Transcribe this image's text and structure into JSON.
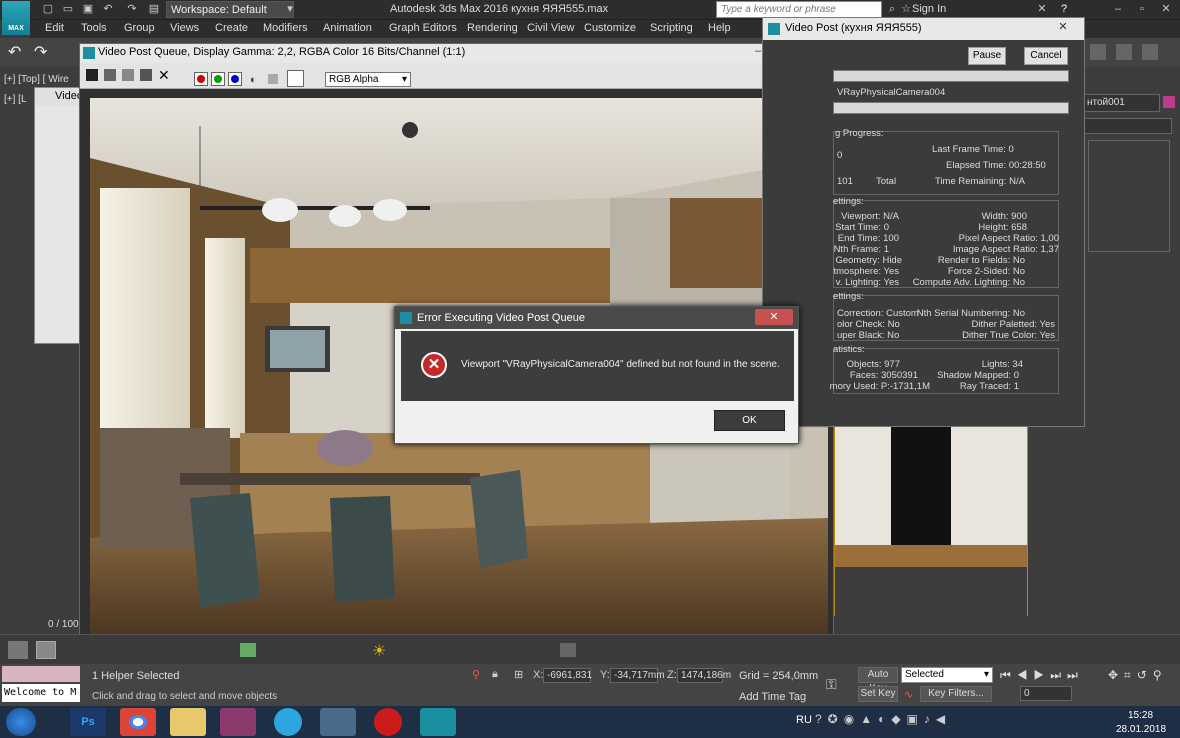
{
  "app": {
    "title": "Autodesk 3ds Max 2016      кухня ЯЯЯ555.max",
    "logo": "MAX",
    "workspace": "Workspace: Default",
    "search_placeholder": "Type a keyword or phrase",
    "signin": "Sign In"
  },
  "menu": [
    "Edit",
    "Tools",
    "Group",
    "Views",
    "Create",
    "Modifiers",
    "Animation",
    "Graph Editors",
    "Rendering",
    "Civil View",
    "Customize",
    "Scripting",
    "Help"
  ],
  "viewport": {
    "label": "[+] [Top] [ Wire",
    "label2": "[+] [L",
    "frame_counter": "0 / 100",
    "right_label": "нтой001"
  },
  "small_window": {
    "title": "Video"
  },
  "video_post_queue": {
    "title": "Video Post Queue, Display Gamma: 2,2, RGBA Color 16 Bits/Channel (1:1)",
    "channel": "RGB Alpha",
    "swatch_colors": [
      "#d00000",
      "#00a000",
      "#0000d0"
    ]
  },
  "video_post": {
    "title": "Video Post (кухня ЯЯЯ555)",
    "pause": "Pause",
    "cancel": "Cancel",
    "camera": "VRayPhysicalCamera004",
    "progress_label": "g Progress:",
    "last_frame_time": "Last Frame Time:  0",
    "progress_value": "0",
    "elapsed": "Elapsed Time:  00:28:50",
    "total_value": "101",
    "total_label": "Total",
    "remaining": "Time Remaining:  N/A",
    "settings_label": "ettings:",
    "settings_left": [
      "Viewport:  N/A",
      "Start Time:  0",
      "End Time:  100",
      "Nth Frame:  1",
      "Geometry:  Hide",
      "tmosphere:  Yes",
      "v. Lighting:  Yes"
    ],
    "settings_right": [
      "Width:  900",
      "Height:  658",
      "Pixel Aspect Ratio:  1,00",
      "Image Aspect Ratio:  1,37",
      "Render to Fields:  No",
      "Force 2-Sided:  No",
      "Compute Adv. Lighting:  No"
    ],
    "settings2_label": "ettings:",
    "settings2_left": [
      "Correction:  Custom",
      "olor Check:  No",
      "uper Black:  No"
    ],
    "settings2_right": [
      "Nth Serial Numbering:  No",
      "Dither Paletted:  Yes",
      "Dither True Color:  Yes"
    ],
    "stats_label": "atistics:",
    "stats_left": [
      "Objects:  977",
      "Faces:  3050391",
      "mory Used:  P:-1731,1M"
    ],
    "stats_right": [
      "Lights:  34",
      "Shadow Mapped:  0",
      "Ray Traced:  1"
    ]
  },
  "error_dialog": {
    "title": "Error Executing Video Post Queue",
    "message": "Viewport \"VRayPhysicalCamera004\" defined but not found in the scene.",
    "ok": "OK"
  },
  "status": {
    "welcome": "Welcome to M",
    "selected": "1 Helper Selected",
    "hint": "Click and drag to select and move objects",
    "x_label": "X:",
    "x_value": "-6961,831",
    "y_label": "Y:",
    "y_value": "-34,717mm",
    "z_label": "Z:",
    "z_value": "1474,186m",
    "grid": "Grid = 254,0mm",
    "add_time_tag": "Add Time Tag",
    "auto_key": "Auto Key",
    "set_key": "Set Key",
    "key_mode": "Selected",
    "key_filters": "Key Filters...",
    "frame": "0"
  },
  "taskbar": {
    "lang": "RU",
    "time": "15:28",
    "date": "28.01.2018"
  }
}
